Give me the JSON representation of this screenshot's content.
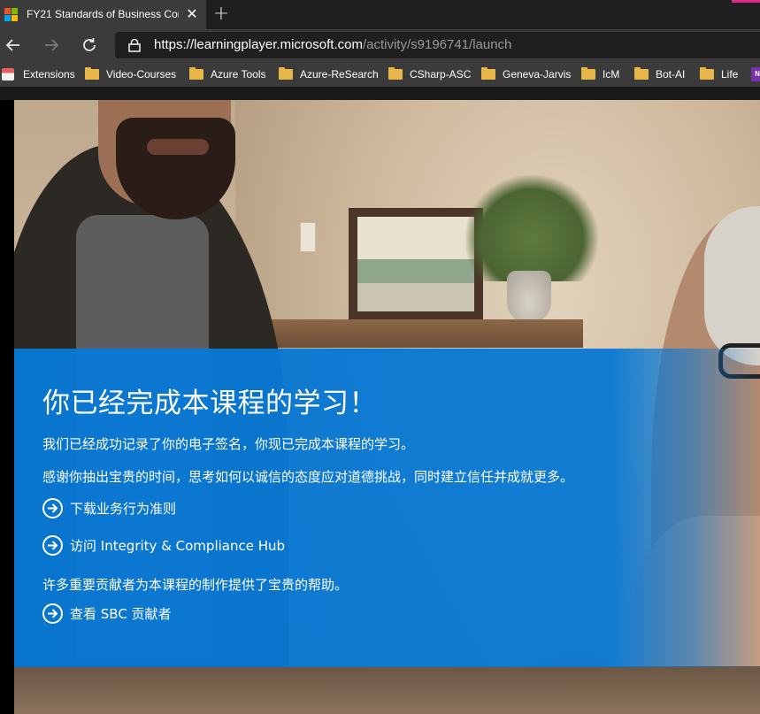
{
  "browser": {
    "tab": {
      "title": "FY21 Standards of Business Conc",
      "close_glyph": "✕"
    },
    "new_tab_glyph": "+",
    "url": {
      "scheme": "https://",
      "host": "learningplayer.microsoft.com",
      "path": "/activity/s9196741/launch"
    },
    "bookmarks": [
      {
        "label": "Extensions",
        "icon": "extensions-icon"
      },
      {
        "label": "Video-Courses",
        "icon": "folder-icon"
      },
      {
        "label": "Azure Tools",
        "icon": "folder-icon"
      },
      {
        "label": "Azure-ReSearch",
        "icon": "folder-icon"
      },
      {
        "label": "CSharp-ASC",
        "icon": "folder-icon"
      },
      {
        "label": "Geneva-Jarvis",
        "icon": "folder-icon"
      },
      {
        "label": "IcM",
        "icon": "folder-icon"
      },
      {
        "label": "Bot-AI",
        "icon": "folder-icon"
      },
      {
        "label": "Life",
        "icon": "folder-icon"
      },
      {
        "label": "N",
        "icon": "onenote-icon"
      }
    ]
  },
  "completion": {
    "title": "你已经完成本课程的学习！",
    "signature_text": "我们已经成功记录了你的电子签名，你现已完成本课程的学习。",
    "thanks_text": "感谢你抽出宝贵的时间，思考如何以诚信的态度应对道德挑战，同时建立信任并成就更多。",
    "link_download": "下载业务行为准则",
    "link_hub": "访问 Integrity & Compliance Hub",
    "contributors_text": "许多重要贡献者为本课程的制作提供了宝贵的帮助。",
    "link_contributors": "查看 SBC 贡献者"
  },
  "colors": {
    "panel_blue": "#0878d4",
    "tab_bg": "#3b3b3b",
    "chrome_dark": "#1f1f1f"
  }
}
